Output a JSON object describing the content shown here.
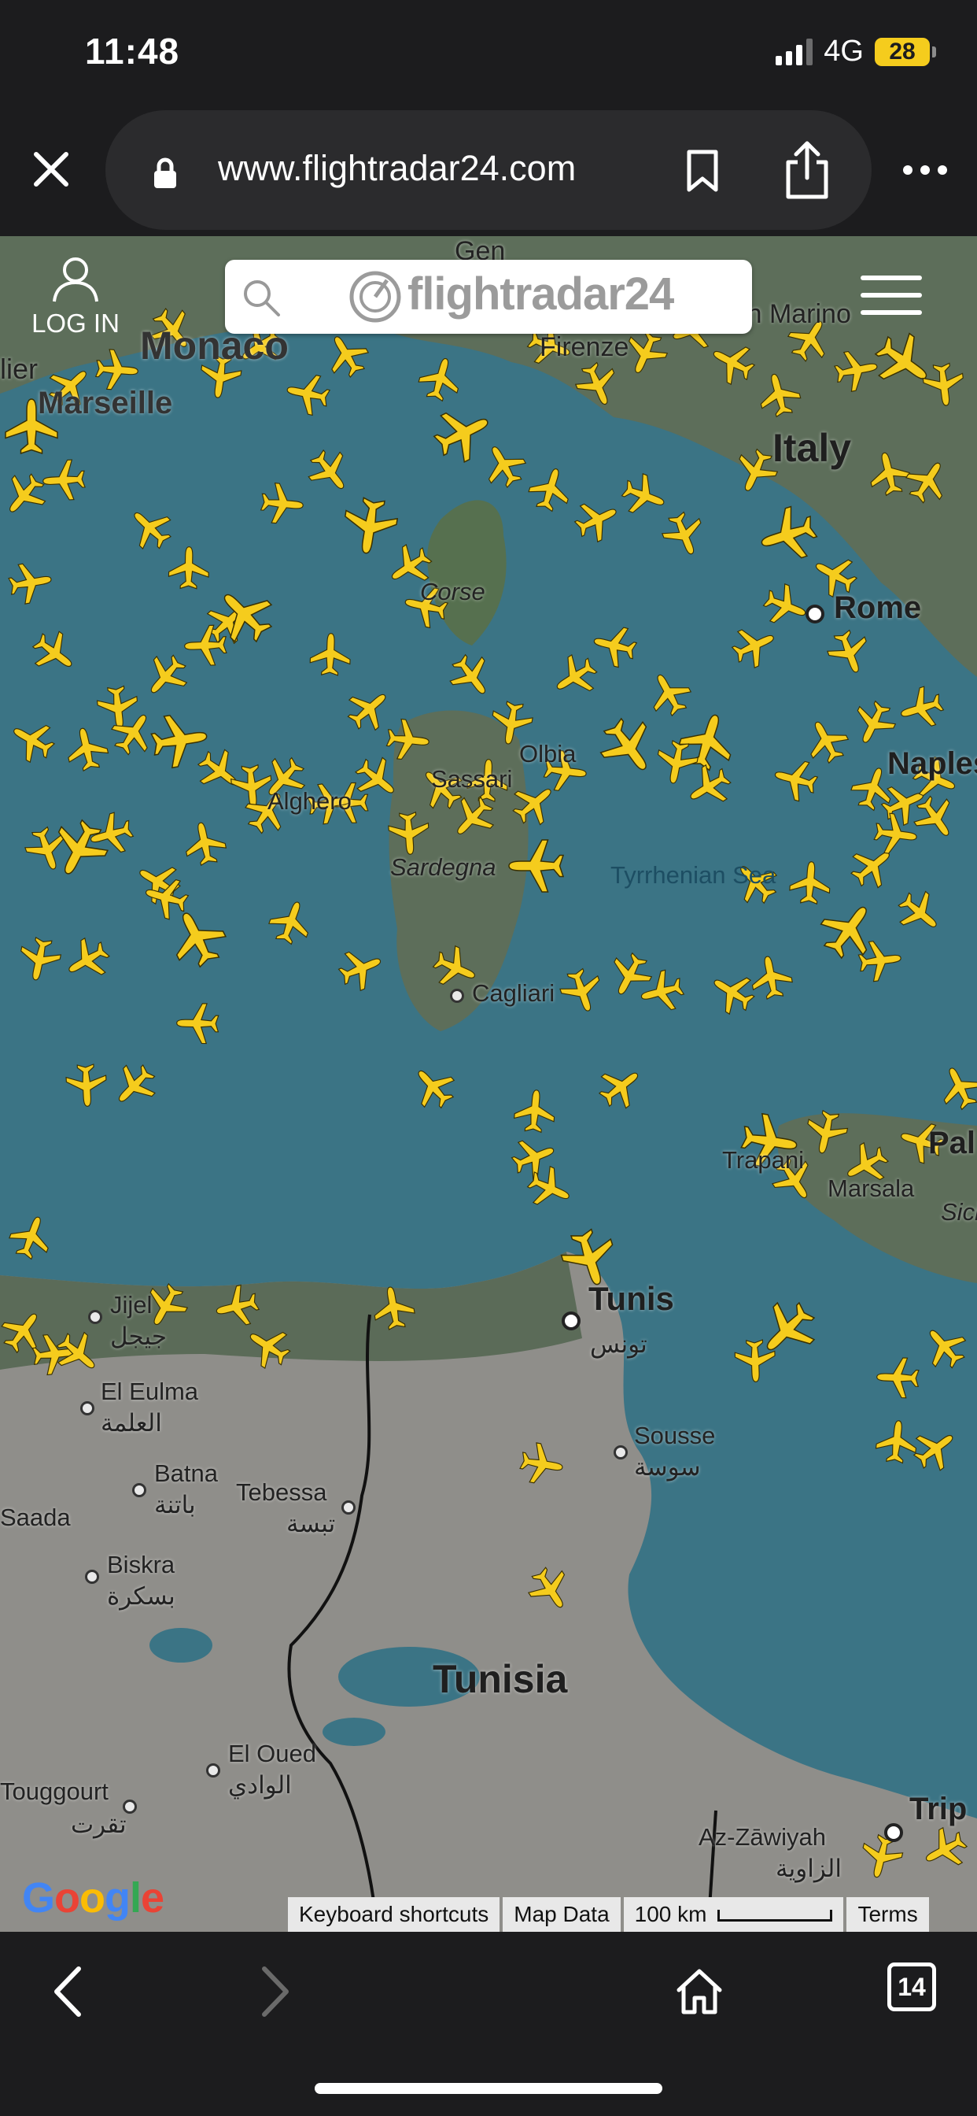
{
  "status_bar": {
    "time": "11:48",
    "network": "4G",
    "battery": "28"
  },
  "browser": {
    "url": "www.flightradar24.com"
  },
  "header": {
    "login_label": "LOG IN",
    "logo_text": "flightradar24"
  },
  "map": {
    "labels": {
      "monaco": "Monaco",
      "marseille": "Marseille",
      "italy": "Italy",
      "corse": "Corse",
      "rome": "Rome",
      "sassari": "Sassari",
      "alghero": "Alghero",
      "olbia": "Olbia",
      "naples": "Naples",
      "sardegna": "Sardegna",
      "tyrrhenian": "Tyrrhenian Sea",
      "cagliari": "Cagliari",
      "trapani": "Trapani",
      "marsala": "Marsala",
      "palermo": "Pal",
      "sicily": "Sici",
      "tunis": "Tunis",
      "tunis_ar": "تونس",
      "jijel": "Jijel",
      "jijel_ar": "جيجل",
      "el_eulma": "El Eulma",
      "el_eulma_ar": "العلمة",
      "sousse": "Sousse",
      "sousse_ar": "سوسة",
      "batna": "Batna",
      "batna_ar": "باتنة",
      "tebessa": "Tebessa",
      "tebessa_ar": "تبسة",
      "saada": "Saada",
      "biskra": "Biskra",
      "biskra_ar": "بسكرة",
      "tunisia": "Tunisia",
      "el_oued": "El Oued",
      "el_oued_ar": "الوادي",
      "touggourt": "Touggourt",
      "touggourt_ar": "تقرت",
      "az_zawiyah": "Az-Zāwiyah",
      "az_zawiyah_ar": "الزاوية",
      "tripoli": "Trip",
      "firenze": "Firenze",
      "genova": "Gen",
      "sanmarino": "San Marino",
      "montpellier": "lier"
    },
    "colors": {
      "sea": "#3b7485",
      "land": "#5f6f5a",
      "plane": "#f5cc1d"
    }
  },
  "map_footer": {
    "google": "Google",
    "keyboard_shortcuts": "Keyboard shortcuts",
    "map_data": "Map Data",
    "scale": "100 km",
    "terms": "Terms"
  },
  "bottom_nav": {
    "tab_count": "14"
  }
}
